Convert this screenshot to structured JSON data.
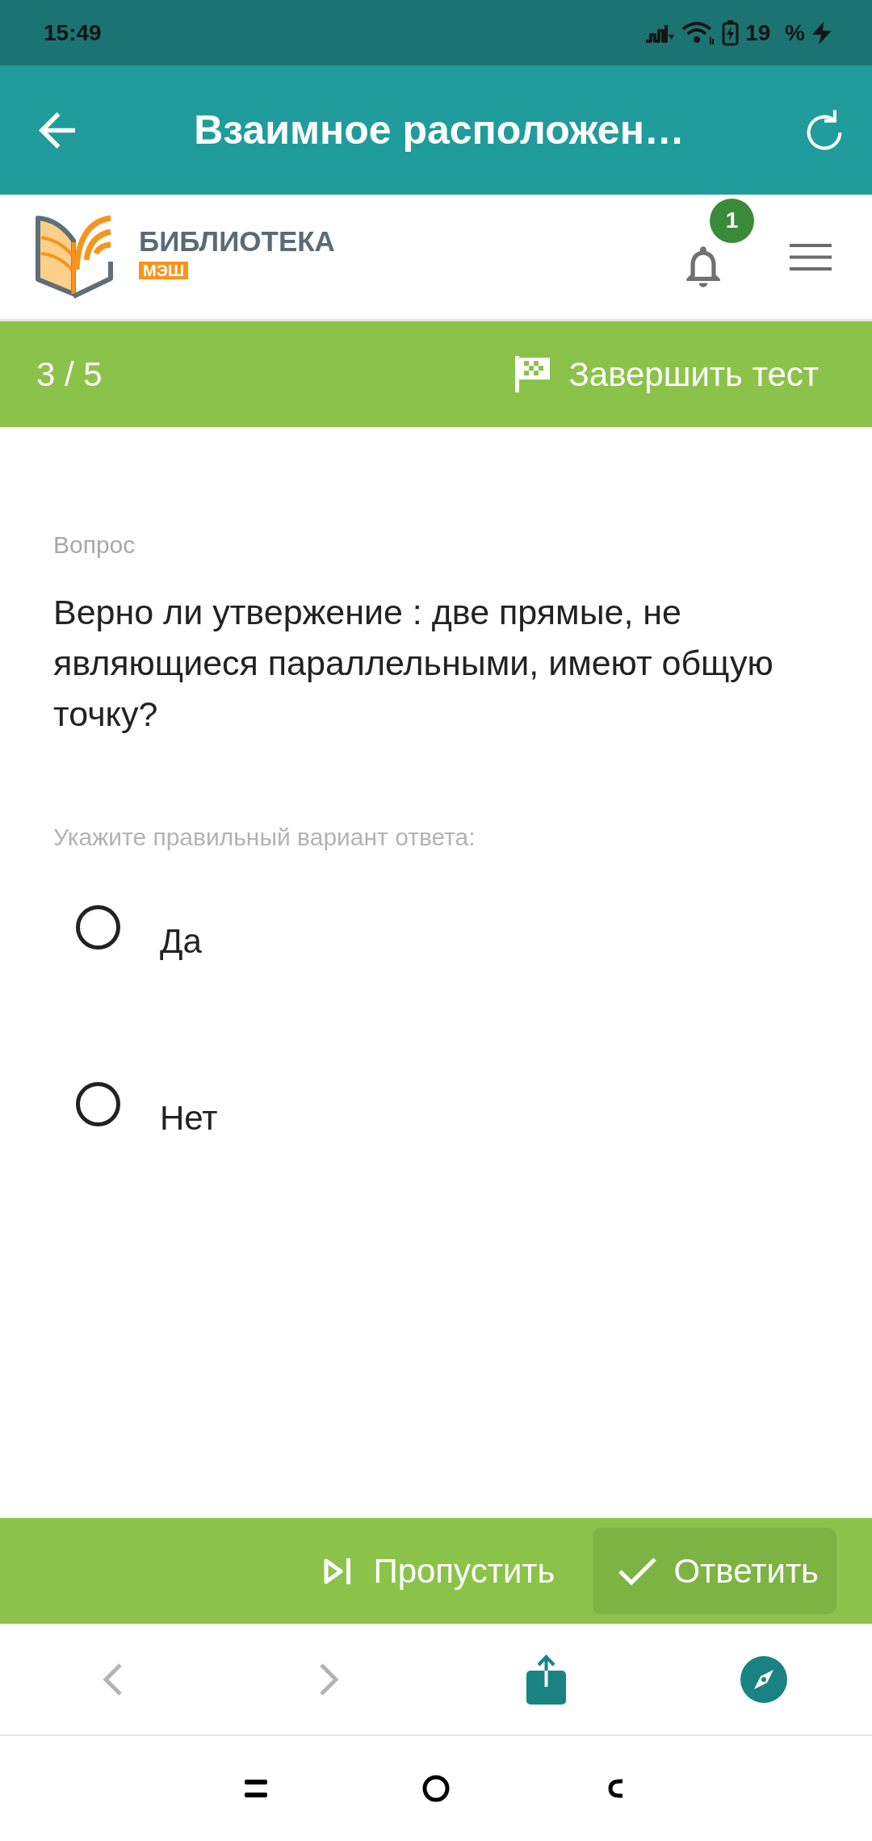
{
  "status_bar": {
    "time": "15:49",
    "battery": "19 %"
  },
  "app_bar": {
    "title": "Взаимное расположен…"
  },
  "header": {
    "logo_title": "БИБЛИОТЕКА",
    "logo_subtitle": "МЭШ",
    "notification_count": "1"
  },
  "progress": {
    "counter": "3 / 5",
    "finish_button": "Завершить тест"
  },
  "question": {
    "label": "Вопрос",
    "text": "Верно ли утвержение : две прямые, не являющиеся параллельными, имеют общую точку?",
    "instruction": "Укажите правильный вариант ответа:",
    "options": [
      {
        "label": "Да",
        "selected": false
      },
      {
        "label": "Нет",
        "selected": false
      }
    ]
  },
  "actions": {
    "skip_button": "Пропустить",
    "answer_button": "Ответить"
  },
  "browser_toolbar": [
    {
      "kind": "back",
      "disabled": true
    },
    {
      "kind": "forward",
      "disabled": true
    },
    {
      "kind": "share",
      "disabled": false
    },
    {
      "kind": "compass",
      "disabled": false
    }
  ]
}
